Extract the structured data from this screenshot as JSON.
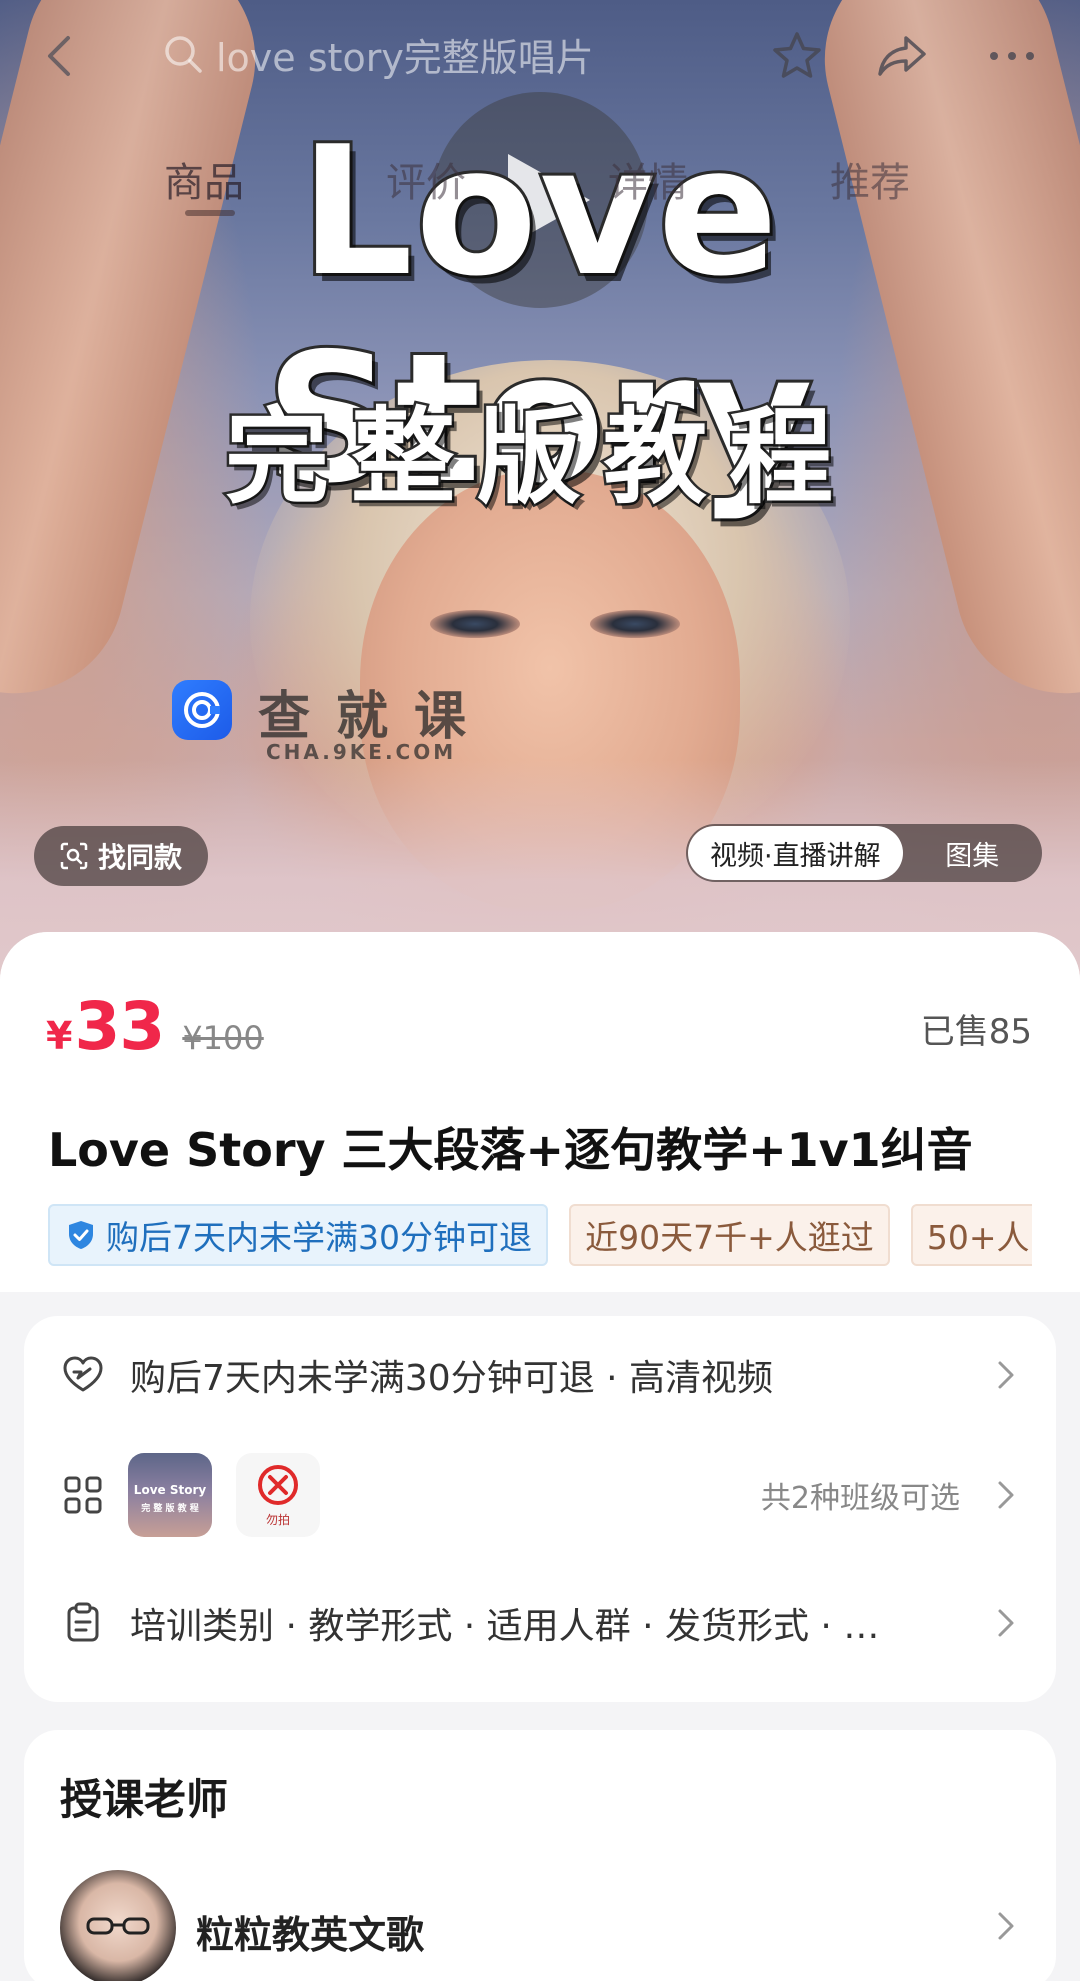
{
  "topbar": {
    "search_text": "love story完整版唱片",
    "icons": [
      "back-arrow",
      "search",
      "star",
      "share",
      "more-dots"
    ]
  },
  "tabs": [
    {
      "label": "商品",
      "active": true
    },
    {
      "label": "评价",
      "active": false
    },
    {
      "label": "详情",
      "active": false
    },
    {
      "label": "推荐",
      "active": false
    }
  ],
  "hero": {
    "title": "Love Story",
    "subtitle": "完整版教程",
    "watermark": {
      "text": "查就课",
      "sub": "CHA.9KE.COM"
    }
  },
  "media": {
    "find_same_label": "找同款",
    "toggle": [
      {
        "label": "视频·直播讲解",
        "active": true
      },
      {
        "label": "图集",
        "active": false
      }
    ]
  },
  "product": {
    "currency": "¥",
    "price": "33",
    "original_price": "¥100",
    "sold": "已售85",
    "title": "Love Story 三大段落+逐句教学+1v1纠音",
    "tags": [
      {
        "label": "购后7天内未学满30分钟可退",
        "style": "blue"
      },
      {
        "label": "近90天7千+人逛过",
        "style": "tan"
      },
      {
        "label": "50+人",
        "style": "tan"
      }
    ]
  },
  "info": {
    "refund_text": "购后7天内未学满30分钟可退 · 高清视频",
    "class_thumb1": {
      "title": "Love Story",
      "sub": "完 整 版 教 程"
    },
    "class_thumb2_label": "勿拍",
    "class_count": "共2种班级可选",
    "attrs_text": "培训类别 · 教学形式 · 适用人群 · 发货形式 · …"
  },
  "teacher": {
    "heading": "授课老师",
    "name": "粒粒教英文歌"
  },
  "colors": {
    "price_red": "#f0274a",
    "tag_blue": "#1f6fbd",
    "tag_tan": "#8a5a3c"
  }
}
